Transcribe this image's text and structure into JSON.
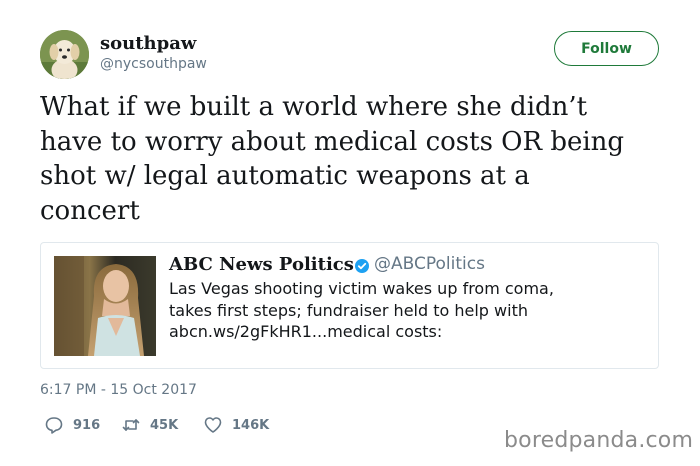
{
  "user": {
    "display_name": "southpaw",
    "handle": "@nycsouthpaw",
    "follow_label": "Follow"
  },
  "tweet": {
    "text_lines": [
      "What if we built a world where she didn’t",
      "have to worry about medical costs OR being",
      "shot w/ legal automatic weapons at a",
      "concert"
    ],
    "timestamp": "6:17 PM - 15 Oct 2017"
  },
  "quoted_tweet": {
    "display_name": "ABC News Politics",
    "handle": "@ABCPolitics",
    "text_lines": [
      "Las Vegas shooting victim wakes up from coma,",
      "takes first steps; fundraiser held to help with",
      "abcn.ws/2gFkHR1...medical costs:"
    ]
  },
  "actions": {
    "replies": "916",
    "retweets": "45K",
    "likes": "146K"
  },
  "watermark": "boredpanda.com",
  "colors": {
    "follow_accent": "#1f7a3a",
    "muted_text": "#657786",
    "verified_blue": "#1da1f2",
    "border": "#e1e8ed"
  },
  "icons": {
    "avatar": "golden-retriever-puppy",
    "verified": "verified-badge-icon",
    "reply": "reply-icon",
    "retweet": "retweet-icon",
    "like": "heart-icon"
  }
}
